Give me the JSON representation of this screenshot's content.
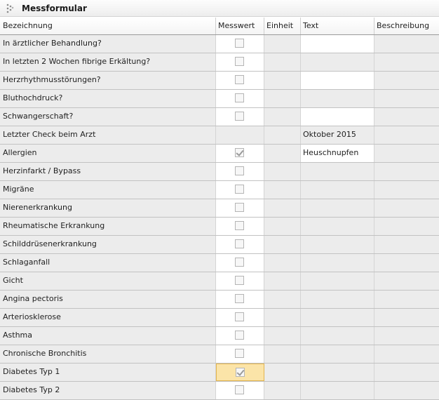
{
  "panel": {
    "title": "Messformular",
    "icon": "grip-icon"
  },
  "table": {
    "headers": [
      "Bezeichnung",
      "Messwert",
      "Einheit",
      "Text",
      "Beschreibung"
    ],
    "rows": [
      {
        "label": "In ärztlicher Behandlung?",
        "has_checkbox": true,
        "checked": false,
        "text": "",
        "text_editable": true
      },
      {
        "label": "In letzten 2 Wochen fibrige Erkältung?",
        "has_checkbox": true,
        "checked": false,
        "text": "",
        "text_editable": false
      },
      {
        "label": "Herzrhythmusstörungen?",
        "has_checkbox": true,
        "checked": false,
        "text": "",
        "text_editable": true
      },
      {
        "label": "Bluthochdruck?",
        "has_checkbox": true,
        "checked": false,
        "text": "",
        "text_editable": false
      },
      {
        "label": "Schwangerschaft?",
        "has_checkbox": true,
        "checked": false,
        "text": "",
        "text_editable": true
      },
      {
        "label": "Letzter Check beim Arzt",
        "has_checkbox": false,
        "checked": false,
        "text": "Oktober 2015",
        "text_editable": false
      },
      {
        "label": "Allergien",
        "has_checkbox": true,
        "checked": true,
        "text": "Heuschnupfen",
        "text_editable": true
      },
      {
        "label": "Herzinfarkt / Bypass",
        "has_checkbox": true,
        "checked": false,
        "text": "",
        "text_editable": false
      },
      {
        "label": "Migräne",
        "has_checkbox": true,
        "checked": false,
        "text": "",
        "text_editable": false
      },
      {
        "label": "Nierenerkrankung",
        "has_checkbox": true,
        "checked": false,
        "text": "",
        "text_editable": false
      },
      {
        "label": "Rheumatische Erkrankung",
        "has_checkbox": true,
        "checked": false,
        "text": "",
        "text_editable": false
      },
      {
        "label": "Schilddrüsenerkrankung",
        "has_checkbox": true,
        "checked": false,
        "text": "",
        "text_editable": false
      },
      {
        "label": "Schlaganfall",
        "has_checkbox": true,
        "checked": false,
        "text": "",
        "text_editable": false
      },
      {
        "label": "Gicht",
        "has_checkbox": true,
        "checked": false,
        "text": "",
        "text_editable": false
      },
      {
        "label": "Angina pectoris",
        "has_checkbox": true,
        "checked": false,
        "text": "",
        "text_editable": false
      },
      {
        "label": "Arteriosklerose",
        "has_checkbox": true,
        "checked": false,
        "text": "",
        "text_editable": false
      },
      {
        "label": "Asthma",
        "has_checkbox": true,
        "checked": false,
        "text": "",
        "text_editable": false
      },
      {
        "label": "Chronische Bronchitis",
        "has_checkbox": true,
        "checked": false,
        "text": "",
        "text_editable": false
      },
      {
        "label": "Diabetes Typ 1",
        "has_checkbox": true,
        "checked": true,
        "text": "",
        "text_editable": false,
        "selected": true
      },
      {
        "label": "Diabetes Typ 2",
        "has_checkbox": true,
        "checked": false,
        "text": "",
        "text_editable": false
      }
    ]
  }
}
